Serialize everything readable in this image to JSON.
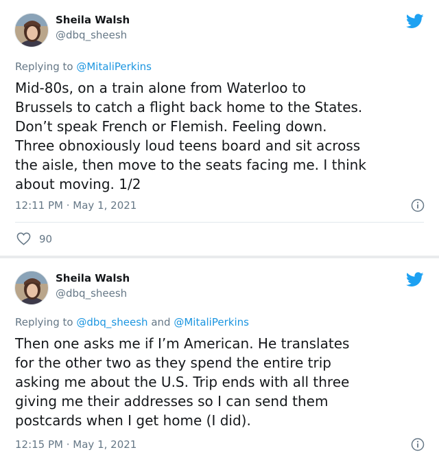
{
  "tweets": [
    {
      "author_name": "Sheila Walsh",
      "author_handle": "@dbq_sheesh",
      "replying_prefix": "Replying to",
      "replying_to": [
        "@MitaliPerkins"
      ],
      "text": "Mid-80s, on a train alone from Waterloo to\nBrussels to catch a flight back home to the States.\nDon’t speak French or Flemish. Feeling down.\nThree obnoxiously loud teens board and sit across\nthe aisle, then move to the seats facing me. I think\nabout moving. 1/2",
      "timestamp": "12:11 PM · May 1, 2021",
      "like_count": "90"
    },
    {
      "author_name": "Sheila Walsh",
      "author_handle": "@dbq_sheesh",
      "replying_prefix": "Replying to",
      "replying_to": [
        "@dbq_sheesh",
        "@MitaliPerkins"
      ],
      "replying_joiner": "and",
      "text": "Then one asks me if I’m American. He translates\nfor the other two as they spend the entire trip\nasking me about the U.S. Trip ends with all three\ngiving me their addresses so I can send them\npostcards when I get home (I did).",
      "timestamp": "12:15 PM · May 1, 2021"
    }
  ],
  "icons": {
    "brand": "twitter-bird-icon",
    "info": "info-icon",
    "like": "heart-icon"
  },
  "colors": {
    "brand_blue": "#1da1f2",
    "mention_blue": "#1b95e0",
    "secondary_text": "#657786",
    "primary_text": "#14171a",
    "divider": "#e1e8ed",
    "page_background": "#e9ebed"
  }
}
